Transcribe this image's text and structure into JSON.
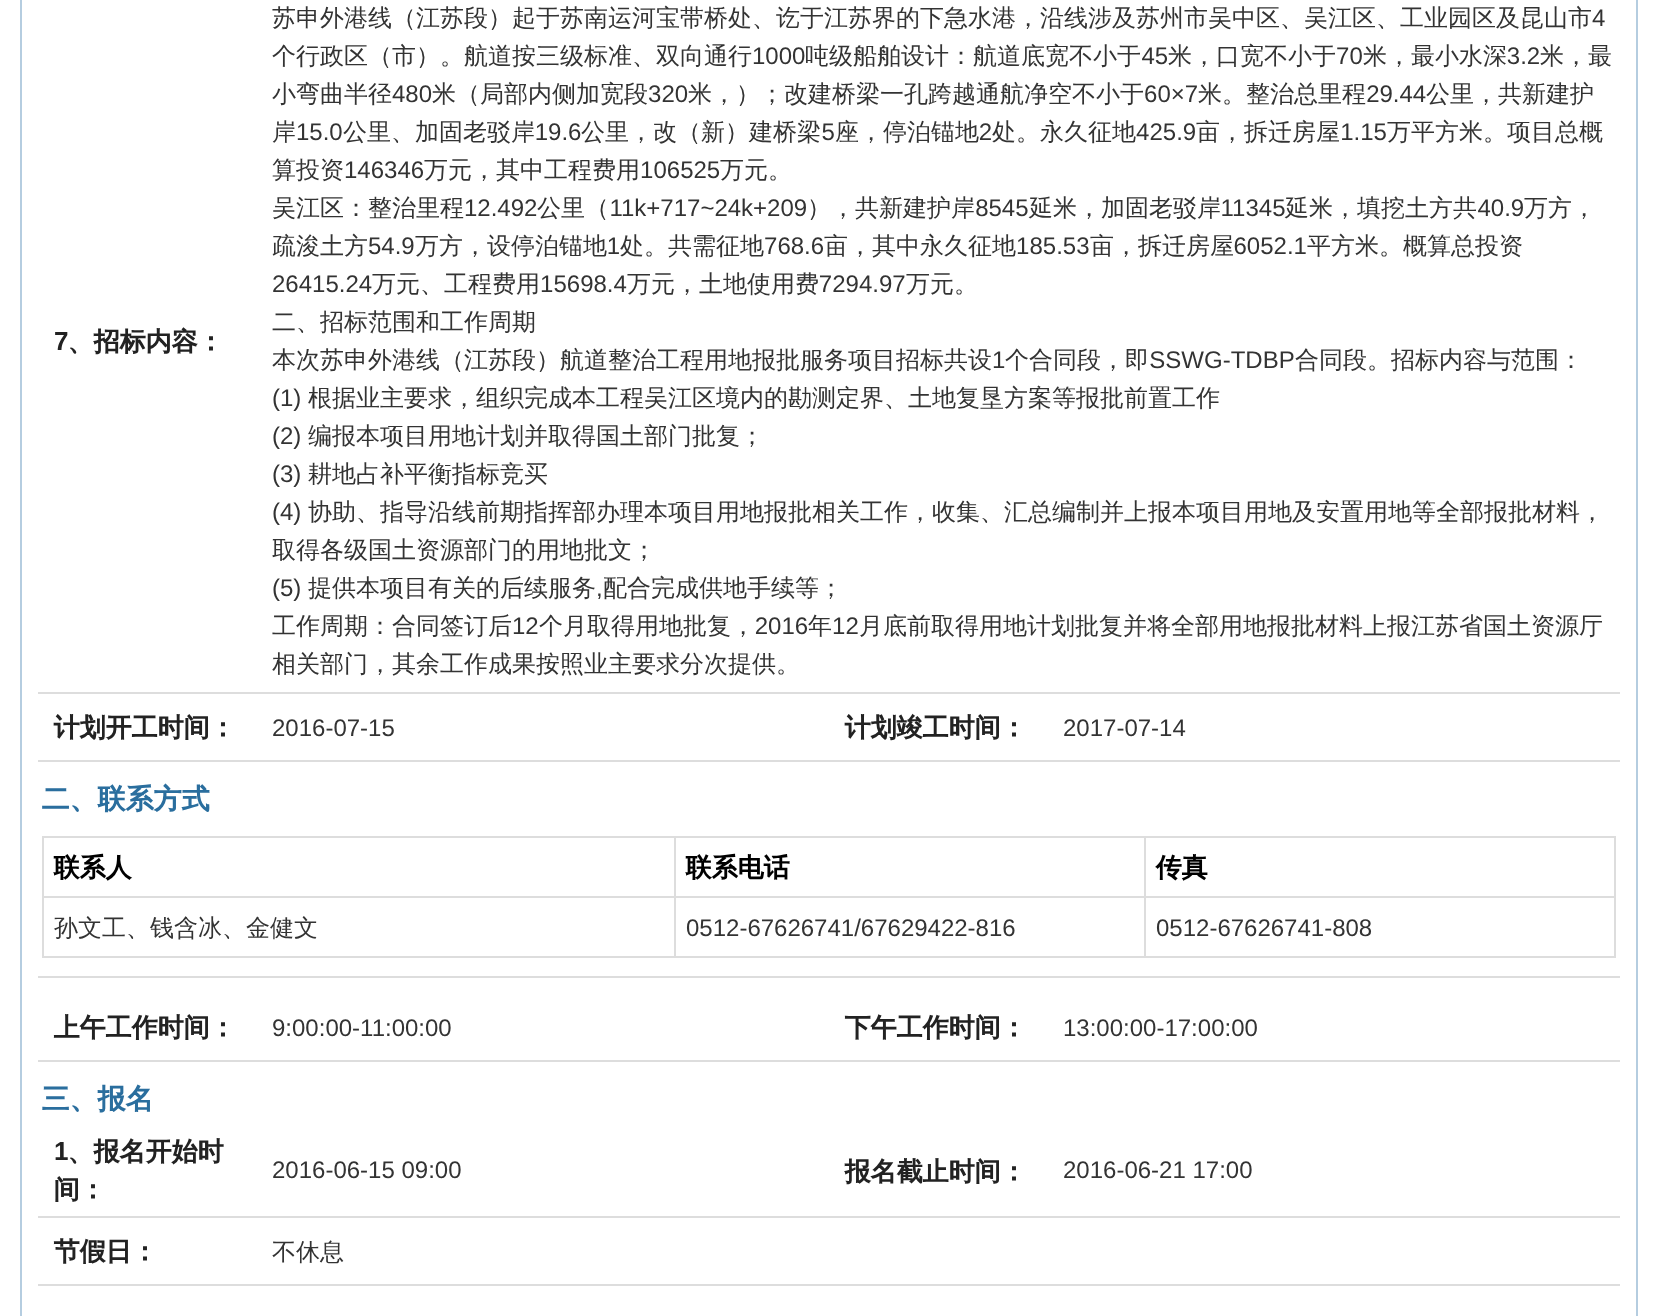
{
  "tender_content": {
    "label": "7、招标内容：",
    "paragraphs": [
      "苏申外港线（江苏段）起于苏南运河宝带桥处、讫于江苏界的下急水港，沿线涉及苏州市吴中区、吴江区、工业园区及昆山市4个行政区（市）。航道按三级标准、双向通行1000吨级船舶设计：航道底宽不小于45米，口宽不小于70米，最小水深3.2米，最小弯曲半径480米（局部内侧加宽段320米，）；改建桥梁一孔跨越通航净空不小于60×7米。整治总里程29.44公里，共新建护岸15.0公里、加固老驳岸19.6公里，改（新）建桥梁5座，停泊锚地2处。永久征地425.9亩，拆迁房屋1.15万平方米。项目总概算投资146346万元，其中工程费用106525万元。",
      "吴江区：整治里程12.492公里（11k+717~24k+209），共新建护岸8545延米，加固老驳岸11345延米，填挖土方共40.9万方，疏浚土方54.9万方，设停泊锚地1处。共需征地768.6亩，其中永久征地185.53亩，拆迁房屋6052.1平方米。概算总投资26415.24万元、工程费用15698.4万元，土地使用费7294.97万元。",
      "二、招标范围和工作周期",
      "本次苏申外港线（江苏段）航道整治工程用地报批服务项目招标共设1个合同段，即SSWG-TDBP合同段。招标内容与范围：",
      "(1) 根据业主要求，组织完成本工程吴江区境内的勘测定界、土地复垦方案等报批前置工作",
      "(2) 编报本项目用地计划并取得国土部门批复；",
      "(3) 耕地占补平衡指标竞买",
      "(4) 协助、指导沿线前期指挥部办理本项目用地报批相关工作，收集、汇总编制并上报本项目用地及安置用地等全部报批材料，取得各级国土资源部门的用地批文；",
      "(5) 提供本项目有关的后续服务,配合完成供地手续等；",
      "工作周期：合同签订后12个月取得用地批复，2016年12月底前取得用地计划批复并将全部用地报批材料上报江苏省国土资源厅相关部门，其余工作成果按照业主要求分次提供。"
    ]
  },
  "schedule": [
    {
      "label": "计划开工时间：",
      "value": "2016-07-15"
    },
    {
      "label": "计划竣工时间：",
      "value": "2017-07-14"
    }
  ],
  "contact_section": {
    "title": "二、联系方式",
    "columns": [
      "联系人",
      "联系电话",
      "传真"
    ],
    "rows": [
      [
        "孙文工、钱含冰、金健文",
        "0512-67626741/67629422-816",
        "0512-67626741-808"
      ]
    ]
  },
  "work_hours": [
    {
      "label": "上午工作时间：",
      "value": "9:00:00-11:00:00"
    },
    {
      "label": "下午工作时间：",
      "value": "13:00:00-17:00:00"
    }
  ],
  "registration_section": {
    "title": "三、报名",
    "rows": [
      [
        {
          "label": "1、报名开始时间：",
          "value": "2016-06-15 09:00"
        },
        {
          "label": "报名截止时间：",
          "value": "2016-06-21 17:00"
        }
      ],
      [
        {
          "label": "节假日：",
          "value": "不休息"
        }
      ]
    ]
  }
}
